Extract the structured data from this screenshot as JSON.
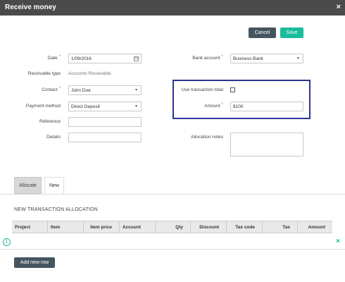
{
  "dialog": {
    "title": "Receive money",
    "close_symbol": "×"
  },
  "actions": {
    "cancel_label": "Cancel",
    "save_label": "Save"
  },
  "form": {
    "date": {
      "label": "Date",
      "required_mark": "*",
      "value": "1/09/2016"
    },
    "receivable_type": {
      "label": "Receivable type",
      "value": "Accounts Receivable"
    },
    "contact": {
      "label": "Contact",
      "required_mark": "*",
      "value": "John Doe"
    },
    "payment_method": {
      "label": "Payment method",
      "value": "Direct Deposit"
    },
    "reference": {
      "label": "Reference",
      "value": ""
    },
    "details": {
      "label": "Details",
      "value": ""
    },
    "bank_account": {
      "label": "Bank account",
      "required_mark": "*",
      "value": "Business Bank"
    },
    "use_transaction_total": {
      "label": "Use transaction total",
      "checked": false
    },
    "amount": {
      "label": "Amount",
      "required_mark": "*",
      "value": "$100"
    },
    "allocation_notes": {
      "label": "Allocation notes",
      "value": ""
    }
  },
  "tabs": [
    {
      "label": "Allocate",
      "active": false
    },
    {
      "label": "New",
      "active": true
    }
  ],
  "allocation": {
    "section_title": "NEW TRANSACTION ALLOCATION",
    "columns": [
      "Project",
      "Item",
      "Item price",
      "Account",
      "Qty",
      "Discount",
      "Tax code",
      "Tax",
      "Amount"
    ],
    "info_icon": "i",
    "row_remove_symbol": "×",
    "add_row_label": "Add new row"
  },
  "colors": {
    "titlebar": "#4a4a4a",
    "primary": "#1abc9c",
    "secondary": "#455560",
    "highlight_border": "#2e3192",
    "required": "#d9534f"
  }
}
